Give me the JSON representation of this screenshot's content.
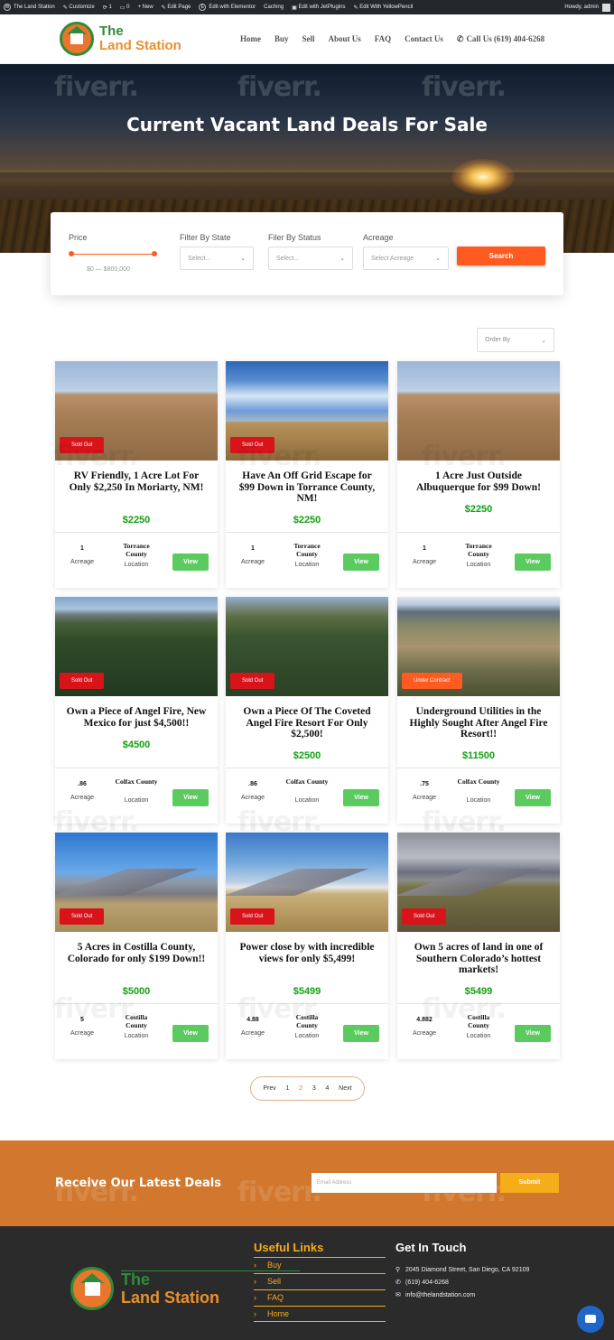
{
  "admin_bar": {
    "items": [
      "The Land Station",
      "Customize",
      "1",
      "0",
      "+ New",
      "Edit Page",
      "Edit with Elementor",
      "Caching",
      "Edit with JetPlugins",
      "Edit With YellowPencil"
    ],
    "greeting": "Howdy, admin"
  },
  "header": {
    "logo_line1": "The",
    "logo_line2": "Land Station",
    "nav": [
      "Home",
      "Buy",
      "Sell",
      "About Us",
      "FAQ",
      "Contact Us"
    ],
    "phone": "Call Us (619) 404-6268"
  },
  "hero": {
    "title": "Current Vacant Land Deals For Sale"
  },
  "watermark": "fiverr.",
  "filters": {
    "price_label": "Price",
    "price_range": "$0 — $800,000",
    "state_label": "Filter By State",
    "state_value": "Select...",
    "status_label": "Filer By Status",
    "status_value": "Select...",
    "acreage_label": "Acreage",
    "acreage_value": "Select Acreage",
    "search_label": "Search"
  },
  "order_by": "Order By",
  "listings": [
    {
      "title": "RV Friendly, 1 Acre Lot For Only $2,250 In Moriarty, NM!",
      "price": "$2250",
      "acreage": "1",
      "acreage_label": "Acreage",
      "county": "Torrance County",
      "location_label": "Location",
      "badge": "Sold Out",
      "view": "View"
    },
    {
      "title": "Have An Off Grid Escape for $99 Down in Torrance County, NM!",
      "price": "$2250",
      "acreage": "1",
      "acreage_label": "Acreage",
      "county": "Torrance County",
      "location_label": "Location",
      "badge": "Sold Out",
      "view": "View"
    },
    {
      "title": "1 Acre Just Outside Albuquerque for $99 Down!",
      "price": "$2250",
      "acreage": "1",
      "acreage_label": "Acreage",
      "county": "Torrance County",
      "location_label": "Location",
      "badge": "",
      "view": "View"
    },
    {
      "title": "Own a Piece of Angel Fire, New Mexico for just $4,500!!",
      "price": "$4500",
      "acreage": ".86",
      "acreage_label": "Acreage",
      "county": "Colfax County",
      "location_label": "Location",
      "badge": "Sold Out",
      "view": "View"
    },
    {
      "title": "Own a Piece Of The Coveted Angel Fire Resort For Only $2,500!",
      "price": "$2500",
      "acreage": ".86",
      "acreage_label": "Acreage",
      "county": "Colfax County",
      "location_label": "Location",
      "badge": "Sold Out",
      "view": "View"
    },
    {
      "title": "Underground Utilities in the Highly Sought After Angel Fire Resort!!",
      "price": "$11500",
      "acreage": ".75",
      "acreage_label": "Acreage",
      "county": "Colfax County",
      "location_label": "Location",
      "badge": "Under Contract",
      "view": "View"
    },
    {
      "title": "5 Acres in Costilla County, Colorado for only $199 Down!!",
      "price": "$5000",
      "acreage": "5",
      "acreage_label": "Acreage",
      "county": "Costilla County",
      "location_label": "Location",
      "badge": "Sold Out",
      "view": "View"
    },
    {
      "title": "Power close by with incredible views for only $5,499!",
      "price": "$5499",
      "acreage": "4.88",
      "acreage_label": "Acreage",
      "county": "Costilla County",
      "location_label": "Location",
      "badge": "Sold Out",
      "view": "View"
    },
    {
      "title": "Own 5 acres of land in one of Southern Colorado’s hottest markets!",
      "price": "$5499",
      "acreage": "4.882",
      "acreage_label": "Acreage",
      "county": "Costilla County",
      "location_label": "Location",
      "badge": "Sold Out",
      "view": "View"
    }
  ],
  "pagination": {
    "prev": "Prev",
    "pages": [
      "1",
      "2",
      "3",
      "4"
    ],
    "current": "2",
    "next": "Next"
  },
  "newsletter": {
    "title": "Receive Our Latest Deals",
    "placeholder": "Email Address",
    "submit": "Submit"
  },
  "footer": {
    "logo_line1": "The",
    "logo_line2": "Land Station",
    "links_title": "Useful Links",
    "links": [
      "Buy",
      "Sell",
      "FAQ",
      "Home"
    ],
    "contact_title": "Get In Touch",
    "address": "2045 Diamond Street, San Diego, CA 92109",
    "phone": "(619) 404-6268",
    "email": "info@thelandstation.com"
  },
  "colors": {
    "accent": "#ff5a1f",
    "price_green": "#12a012",
    "view_green": "#5ccb5f",
    "sold_red": "#d8141a",
    "newsletter_orange": "#d2782e",
    "footer_bg": "#2b2b2b",
    "link_gold": "#f5ad1a",
    "logo_green": "#2e8b3a"
  },
  "icons": [
    "wordpress-icon",
    "customize-icon",
    "updates-icon",
    "comments-icon",
    "phone-icon",
    "chevron-down-icon",
    "chat-icon",
    "location-icon",
    "mail-icon",
    "arrow-right-icon"
  ]
}
